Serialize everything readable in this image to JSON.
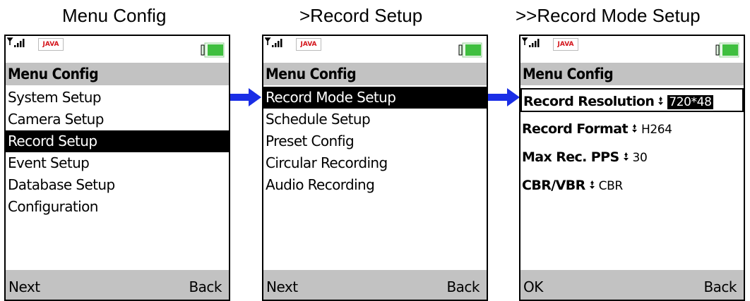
{
  "captions": [
    "Menu Config",
    ">Record Setup",
    ">>Record Mode Setup"
  ],
  "status": {
    "java_logo": "JAVA"
  },
  "screen1": {
    "title": "Menu Config",
    "items": [
      "System Setup",
      "Camera Setup",
      "Record Setup",
      "Event Setup",
      "Database Setup",
      "Configuration"
    ],
    "selected_index": 2,
    "left_softkey": "Next",
    "right_softkey": "Back"
  },
  "screen2": {
    "title": "Menu Config",
    "items": [
      "Record Mode Setup",
      "Schedule Setup",
      "Preset Config",
      "Circular Recording",
      "Audio Recording"
    ],
    "selected_index": 0,
    "left_softkey": "Next",
    "right_softkey": "Back"
  },
  "screen3": {
    "title": "Menu Config",
    "fields": [
      {
        "label": "Record Resolution",
        "value": "720*48"
      },
      {
        "label": "Record Format",
        "value": "H264"
      },
      {
        "label": "Max Rec. PPS",
        "value": "30"
      },
      {
        "label": "CBR/VBR",
        "value": "CBR"
      }
    ],
    "left_softkey": "OK",
    "right_softkey": "Back"
  },
  "colors": {
    "arrow": "#1a2ee6",
    "titlebar": "#c2c2c2",
    "battery": "#3fbf3f"
  }
}
